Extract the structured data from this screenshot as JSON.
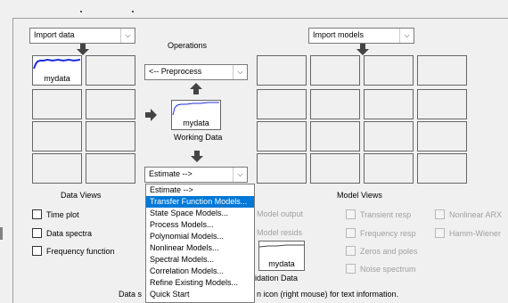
{
  "data_panel": {
    "import_data_label": "Import data",
    "operations_label": "Operations",
    "preprocess_label": "<-- Preprocess",
    "working_data_name": "mydata",
    "working_data_label": "Working Data",
    "estimate_label": "Estimate -->",
    "data_views_label": "Data Views",
    "slot_mydata_label": "mydata"
  },
  "data_views": [
    {
      "label": "Time plot",
      "checked": false
    },
    {
      "label": "Data spectra",
      "checked": false
    },
    {
      "label": "Frequency function",
      "checked": false
    }
  ],
  "models_panel": {
    "import_models_label": "Import models",
    "model_views_label": "Model Views",
    "validation_data_name": "mydata",
    "validation_data_partial": "idation Data"
  },
  "model_views": {
    "model_output": "Model output",
    "model_resids": "Model resids",
    "transient_resp": "Transient resp",
    "frequency_resp": "Frequency resp",
    "zeros_and_poles": "Zeros and poles",
    "noise_spectrum": "Noise spectrum",
    "nonlinear_arx": "Nonlinear ARX",
    "hammerstein_wiener": "Hamm-Wiener"
  },
  "estimate_menu": {
    "selected_index": 1,
    "items": [
      "Estimate -->",
      "Transfer Function Models...",
      "State Space Models...",
      "Process Models...",
      "Polynomial Models...",
      "Nonlinear Models...",
      "Spectral Models...",
      "Correlation Models...",
      "Refine Existing Models...",
      "Quick Start"
    ]
  },
  "status_bar": {
    "left_text": "Data s",
    "right_text": "n icon (right mouse) for text information."
  },
  "colors": {
    "signal_blue": "#1c2dd9",
    "selection_blue": "#0078d7",
    "arrow_gray": "#444444"
  }
}
